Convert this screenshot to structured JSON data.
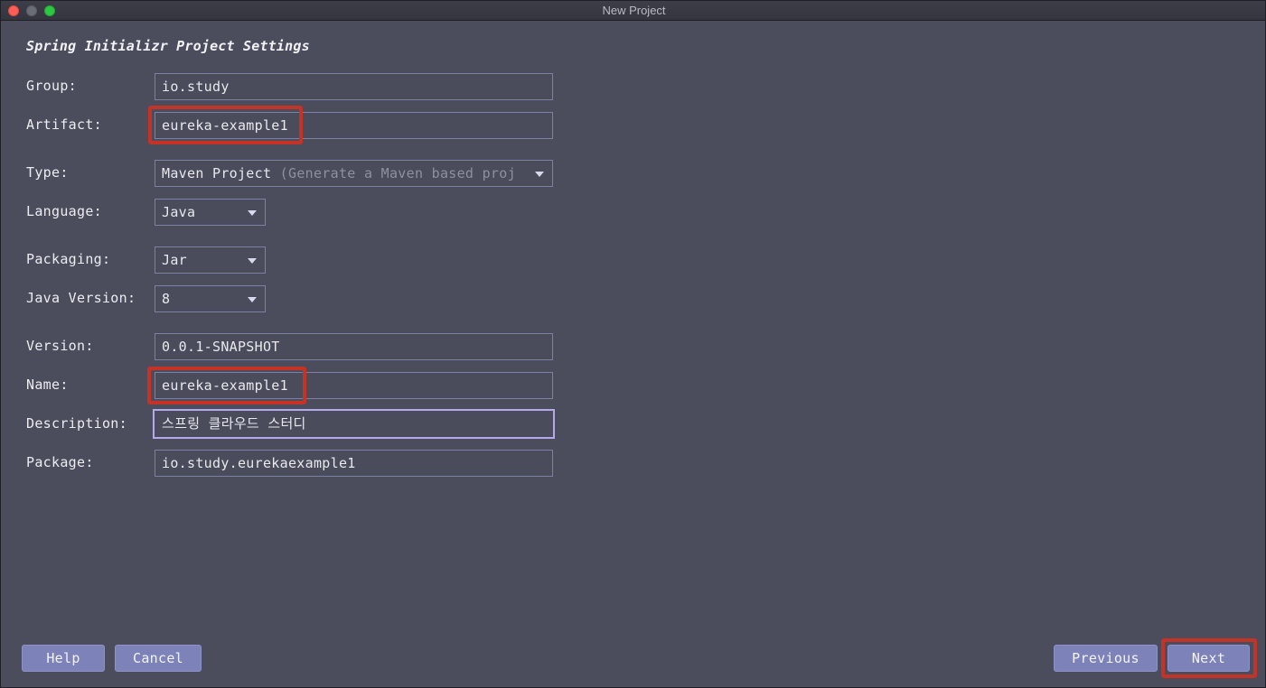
{
  "window": {
    "title": "New Project"
  },
  "section_title": "Spring Initializr Project Settings",
  "fields": {
    "group": {
      "label": "Group:",
      "value": "io.study"
    },
    "artifact": {
      "label": "Artifact:",
      "value": "eureka-example1"
    },
    "type": {
      "label": "Type:",
      "value": "Maven Project",
      "hint": "(Generate a Maven based proj"
    },
    "language": {
      "label": "Language:",
      "value": "Java"
    },
    "packaging": {
      "label": "Packaging:",
      "value": "Jar"
    },
    "java_version": {
      "label": "Java Version:",
      "value": "8"
    },
    "version": {
      "label": "Version:",
      "value": "0.0.1-SNAPSHOT"
    },
    "name": {
      "label": "Name:",
      "value": "eureka-example1"
    },
    "description": {
      "label": "Description:",
      "value": "스프링 클라우드 스터디"
    },
    "package": {
      "label": "Package:",
      "value": "io.study.eurekaexample1"
    }
  },
  "buttons": {
    "help": "Help",
    "cancel": "Cancel",
    "previous": "Previous",
    "next": "Next"
  },
  "colors": {
    "background": "#4b4d5c",
    "field_border": "#7c7fa6",
    "focus_border": "#b7a8ee",
    "button": "#7d83b9",
    "highlight": "#c43325"
  },
  "icons": {
    "dropdown": "chevron-down-icon"
  }
}
